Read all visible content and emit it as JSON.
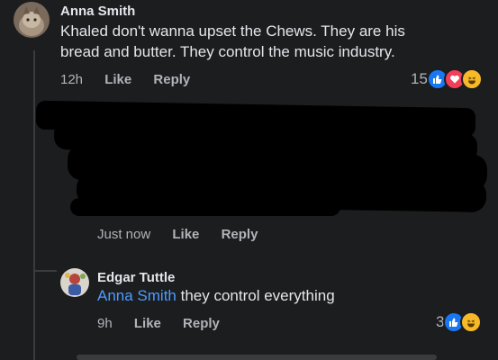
{
  "comments": [
    {
      "author": "Anna Smith",
      "text": "Khaled don't wanna upset the Chews. They are his bread and butter. They control the music industry.",
      "time": "12h",
      "like_label": "Like",
      "reply_label": "Reply",
      "reaction_count": "15",
      "reactions": [
        "like-icon",
        "love-icon",
        "haha-icon"
      ]
    },
    {
      "author": "",
      "text": "",
      "time": "Just now",
      "like_label": "Like",
      "reply_label": "Reply",
      "redacted": true
    },
    {
      "author": "Edgar Tuttle",
      "mention": "Anna Smith",
      "text": "they control everything",
      "time": "9h",
      "like_label": "Like",
      "reply_label": "Reply",
      "reaction_count": "3",
      "reactions": [
        "like-icon",
        "haha-icon"
      ]
    }
  ],
  "colors": {
    "background": "#1c1d1f",
    "text": "#e4e6eb",
    "muted": "#b0b3b8",
    "mention": "#4b9cff",
    "like_blue": "#1877f2",
    "love_red": "#f33e58",
    "haha_yellow": "#f7b928"
  }
}
